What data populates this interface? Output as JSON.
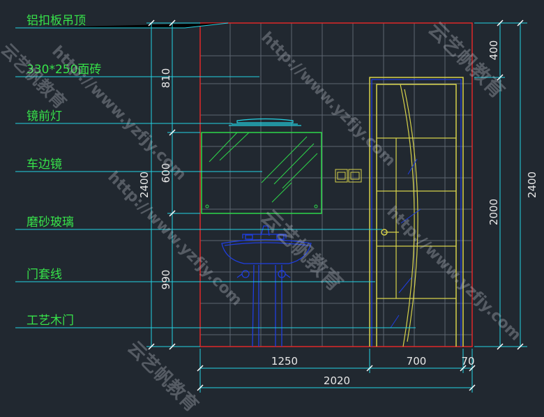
{
  "colors": {
    "background": "#212830",
    "grid": "#5d6670",
    "label_green": "#37e34a",
    "leader_cyan": "#24d3e4",
    "frame_red": "#e02828",
    "door_yellow": "#d7d24a",
    "mirror_green": "#2ed84b",
    "basin_blue": "#1f3ee0",
    "dim_text": "#e8e8e8"
  },
  "labels": [
    {
      "key": "ceiling",
      "text": "铝扣板吊顶"
    },
    {
      "key": "tile",
      "text": "330*250面砖"
    },
    {
      "key": "mirror_light",
      "text": "镜前灯"
    },
    {
      "key": "mirror",
      "text": "车边镜"
    },
    {
      "key": "frosted_glass",
      "text": "磨砂玻璃"
    },
    {
      "key": "door_casing",
      "text": "门套线"
    },
    {
      "key": "wood_door",
      "text": "工艺木门"
    }
  ],
  "dimensions": {
    "left_total": "2400",
    "left_segments": [
      "810",
      "600",
      "990"
    ],
    "right_total": "2400",
    "right_segments": [
      "400",
      "2000"
    ],
    "bottom_segments": [
      "1250",
      "700",
      "70"
    ],
    "bottom_total": "2020"
  },
  "watermarks": [
    "云艺帆教育",
    "http://www.yzfjy.com"
  ]
}
